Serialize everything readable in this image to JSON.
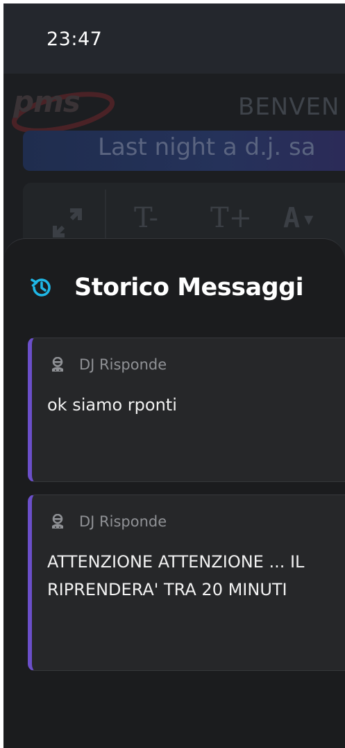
{
  "status_bar": {
    "time": "23:47"
  },
  "background_app": {
    "logo_text": "pms",
    "welcome_text": "BENVEN",
    "marquee_text": "Last night a d.j. sa",
    "toolbar": {
      "expand_icon": "expand-arrows-icon",
      "decrease_font_label": "T-",
      "increase_font_label": "T+",
      "text_color_label": "A"
    }
  },
  "history_sheet": {
    "title": "Storico Messaggi",
    "title_icon": "history-icon",
    "accent_color": "#1fb7e6",
    "card_border_color": "#6b4fc9",
    "messages": [
      {
        "sender": "DJ Risponde",
        "text": "ok siamo rponti"
      },
      {
        "sender": "DJ Risponde",
        "text": "ATTENZIONE ATTENZIONE ... IL\nRIPRENDERA' TRA 20 MINUTI"
      }
    ]
  }
}
